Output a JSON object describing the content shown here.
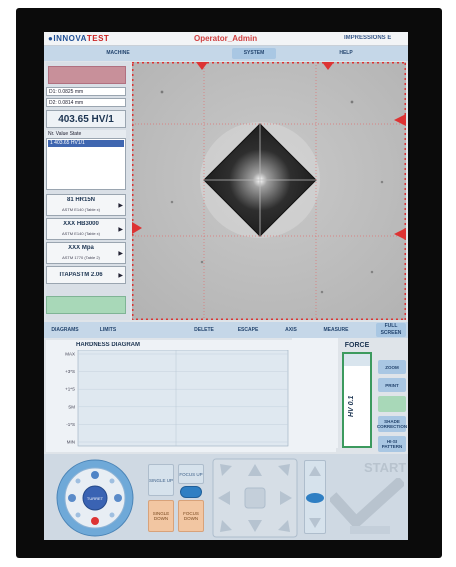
{
  "header": {
    "brand_prefix": "INNOVA",
    "brand_suffix": "TEST",
    "operator": "Operator_Admin",
    "right_label": "IMPRESSIONS E"
  },
  "menu": [
    {
      "label": "",
      "state": "dim"
    },
    {
      "label": "MACHINE",
      "state": "normal"
    },
    {
      "label": "",
      "state": "dim"
    },
    {
      "label": "",
      "state": "dim"
    },
    {
      "label": "SYSTEM",
      "state": "selected"
    },
    {
      "label": "",
      "state": "dim"
    },
    {
      "label": "HELP",
      "state": "normal"
    }
  ],
  "measure": {
    "d1": "D1: 0.0825 mm",
    "d2": "D2: 0.0814 mm",
    "hv": "403.65 HV/1",
    "list_header": "Nr.  Value    State",
    "list_selected": "1   403.65   HV1/1"
  },
  "conversions": [
    {
      "value": "81 HR15N",
      "scale": "ASTM E140 (Table x)"
    },
    {
      "value": "XXX HB3000",
      "scale": "ASTM E140 (Table x)"
    },
    {
      "value": "XXX Mpa",
      "scale": "ASTM 1770 (Table 2)"
    },
    {
      "value": "ITAPASTM 2.06",
      "scale": ""
    }
  ],
  "bottom_tabs": [
    {
      "label": "DIAGRAMS",
      "state": "normal"
    },
    {
      "label": "LIMITS",
      "state": "normal"
    },
    {
      "label": "",
      "state": "dim"
    },
    {
      "label": "DELETE",
      "state": "normal"
    },
    {
      "label": "ESCAPE",
      "state": "normal"
    },
    {
      "label": "AXIS",
      "state": "normal"
    },
    {
      "label": "MEASURE",
      "state": "normal"
    }
  ],
  "fullscreen_label": "FULL SCREEN",
  "diagram": {
    "title": "HARDNESS DIAGRAM"
  },
  "chart_data": {
    "type": "line",
    "title": "HARDNESS DIAGRAM",
    "xlabel": "",
    "ylabel": "",
    "y_ticks": [
      "MAX",
      "+3*S",
      "+1*S",
      "SM",
      "-1*S",
      "MIN"
    ],
    "grid": true,
    "series": []
  },
  "force": {
    "title": "FORCE",
    "value": "HV 0.1"
  },
  "right_buttons": [
    {
      "label": "ZOOM",
      "style": "blue"
    },
    {
      "label": "PRINT",
      "style": "blue"
    },
    {
      "label": "",
      "style": "green"
    },
    {
      "label": "SHADE CORRECTION",
      "style": "blue"
    },
    {
      "label": "HI-SI PATTERN",
      "style": "blue"
    }
  ],
  "controls": {
    "single_up": "SINGLE UP",
    "focus_up": "FOCUS UP",
    "single_down": "SINGLE DOWN",
    "focus_down": "FOCUS DOWN",
    "turret_label": "TURRET",
    "start": "START"
  }
}
